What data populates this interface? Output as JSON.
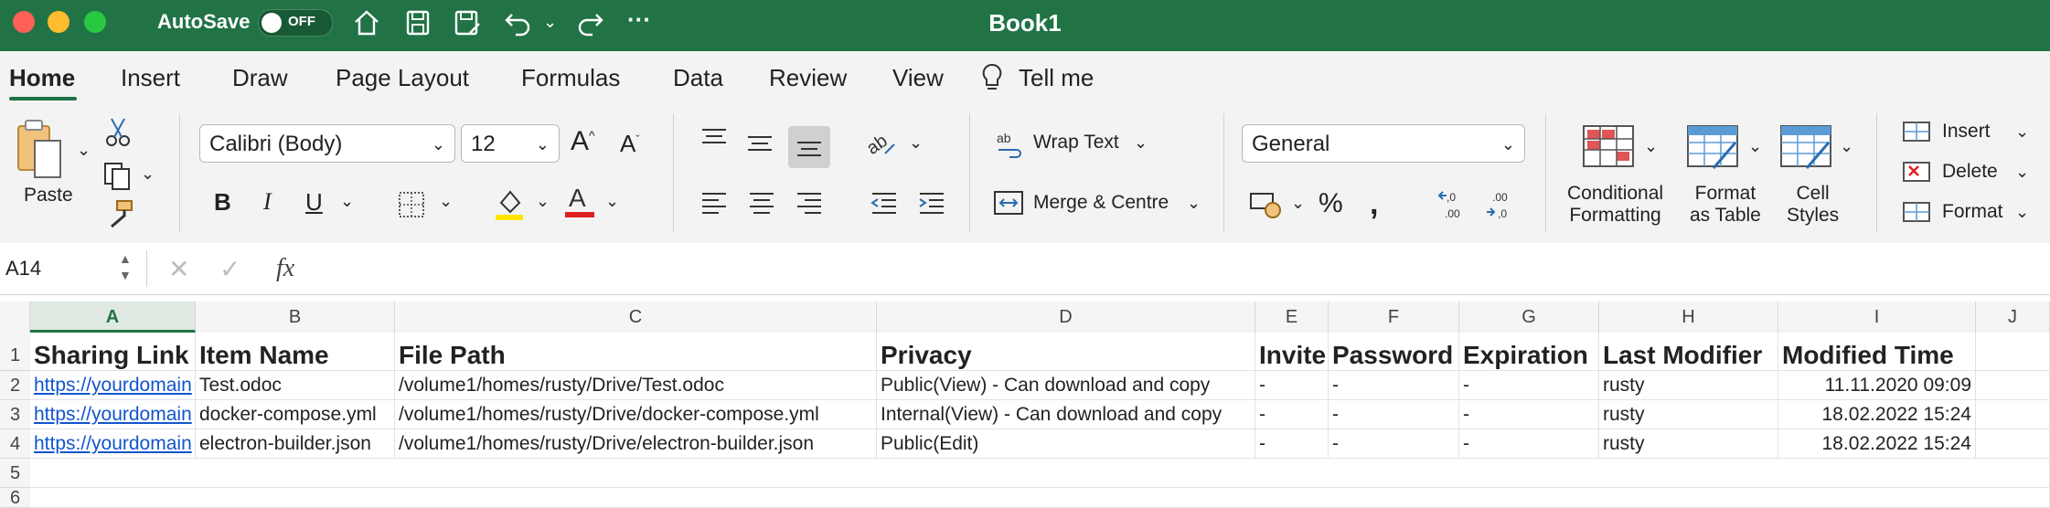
{
  "window": {
    "title": "Book1",
    "autosave_label": "AutoSave",
    "autosave_state": "OFF"
  },
  "tabs": [
    "Home",
    "Insert",
    "Draw",
    "Page Layout",
    "Formulas",
    "Data",
    "Review",
    "View",
    "Tell me"
  ],
  "ribbon": {
    "paste_label": "Paste",
    "font_name": "Calibri (Body)",
    "font_size": "12",
    "wrap_text": "Wrap Text",
    "merge_centre": "Merge & Centre",
    "number_format": "General",
    "conditional": [
      "Conditional",
      "Formatting"
    ],
    "format_table": [
      "Format",
      "as Table"
    ],
    "cell_styles": [
      "Cell",
      "Styles"
    ],
    "insert": "Insert",
    "delete": "Delete",
    "format": "Format",
    "bold": "B",
    "italic": "I",
    "underline": "U",
    "percent": "%"
  },
  "formula_bar": {
    "name_box": "A14",
    "fx": "fx",
    "content": ""
  },
  "grid": {
    "columns": [
      "A",
      "B",
      "C",
      "D",
      "E",
      "F",
      "G",
      "H",
      "I",
      "J"
    ],
    "rows": [
      "1",
      "2",
      "3",
      "4",
      "5",
      "6"
    ],
    "header_row": [
      "Sharing Link",
      "Item Name",
      "File Path",
      "Privacy",
      "Invite",
      "Password",
      "Expiration",
      "Last Modifier",
      "Modified Time"
    ],
    "data": [
      [
        "https://yourdomain",
        "Test.odoc",
        "/volume1/homes/rusty/Drive/Test.odoc",
        "Public(View) - Can download and copy",
        "-",
        "-",
        "-",
        "rusty",
        "11.11.2020 09:09"
      ],
      [
        "https://yourdomain",
        "docker-compose.yml",
        "/volume1/homes/rusty/Drive/docker-compose.yml",
        "Internal(View) - Can download and copy",
        "-",
        "-",
        "-",
        "rusty",
        "18.02.2022 15:24"
      ],
      [
        "https://yourdomain",
        "electron-builder.json",
        "/volume1/homes/rusty/Drive/electron-builder.json",
        "Public(Edit)",
        "-",
        "-",
        "-",
        "rusty",
        "18.02.2022 15:24"
      ]
    ]
  },
  "colors": {
    "title_bar": "#217346",
    "link": "#1155cc",
    "font_color_bar": "#e02020",
    "highlight_bar": "#ffe600"
  }
}
